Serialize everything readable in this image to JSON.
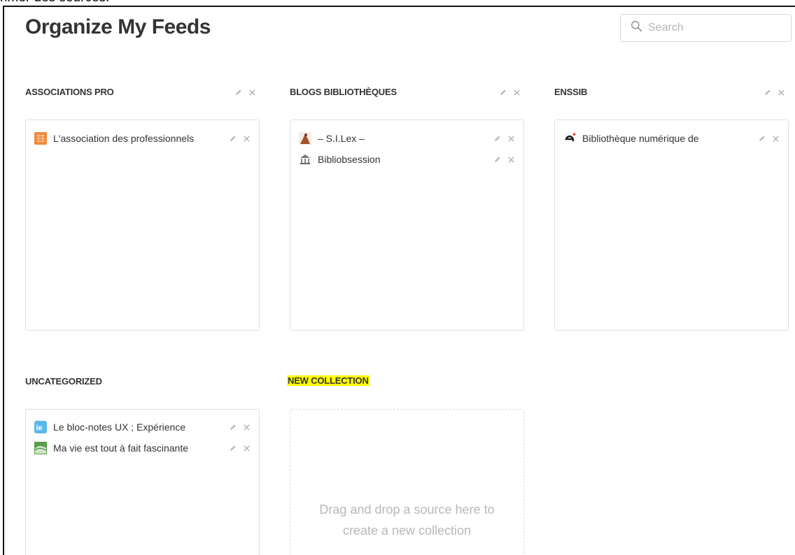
{
  "top_fragment": "rimer des sources.",
  "page": {
    "title": "Organize My Feeds"
  },
  "search": {
    "placeholder": "Search"
  },
  "collections": [
    {
      "name": "ASSOCIATIONS PRO",
      "items": [
        {
          "label": "L'association des professionnels",
          "icon": "orange-grid-favicon"
        }
      ]
    },
    {
      "name": "BLOGS BIBLIOTHÈQUES",
      "items": [
        {
          "label": "– S.I.Lex –",
          "icon": "brown-figure-favicon"
        },
        {
          "label": "Bibliobsession",
          "icon": "building-favicon"
        }
      ]
    },
    {
      "name": "ENSSIB",
      "items": [
        {
          "label": "Bibliothèque numérique de",
          "icon": "e-logo-favicon"
        }
      ]
    },
    {
      "name": "UNCATEGORIZED",
      "items": [
        {
          "label": "Le bloc-notes UX ; Expérience",
          "icon": "ie-blue-favicon"
        },
        {
          "label": "Ma vie est tout à fait fascinante",
          "icon": "green-wave-favicon"
        }
      ]
    }
  ],
  "new_collection": {
    "name": "NEW COLLECTION",
    "drop_line1": "Drag and drop a source here to",
    "drop_line2": "create a new collection"
  },
  "colors": {
    "highlight": "#ffff00",
    "border": "#e0e0e0",
    "muted": "#b8b8b8"
  }
}
